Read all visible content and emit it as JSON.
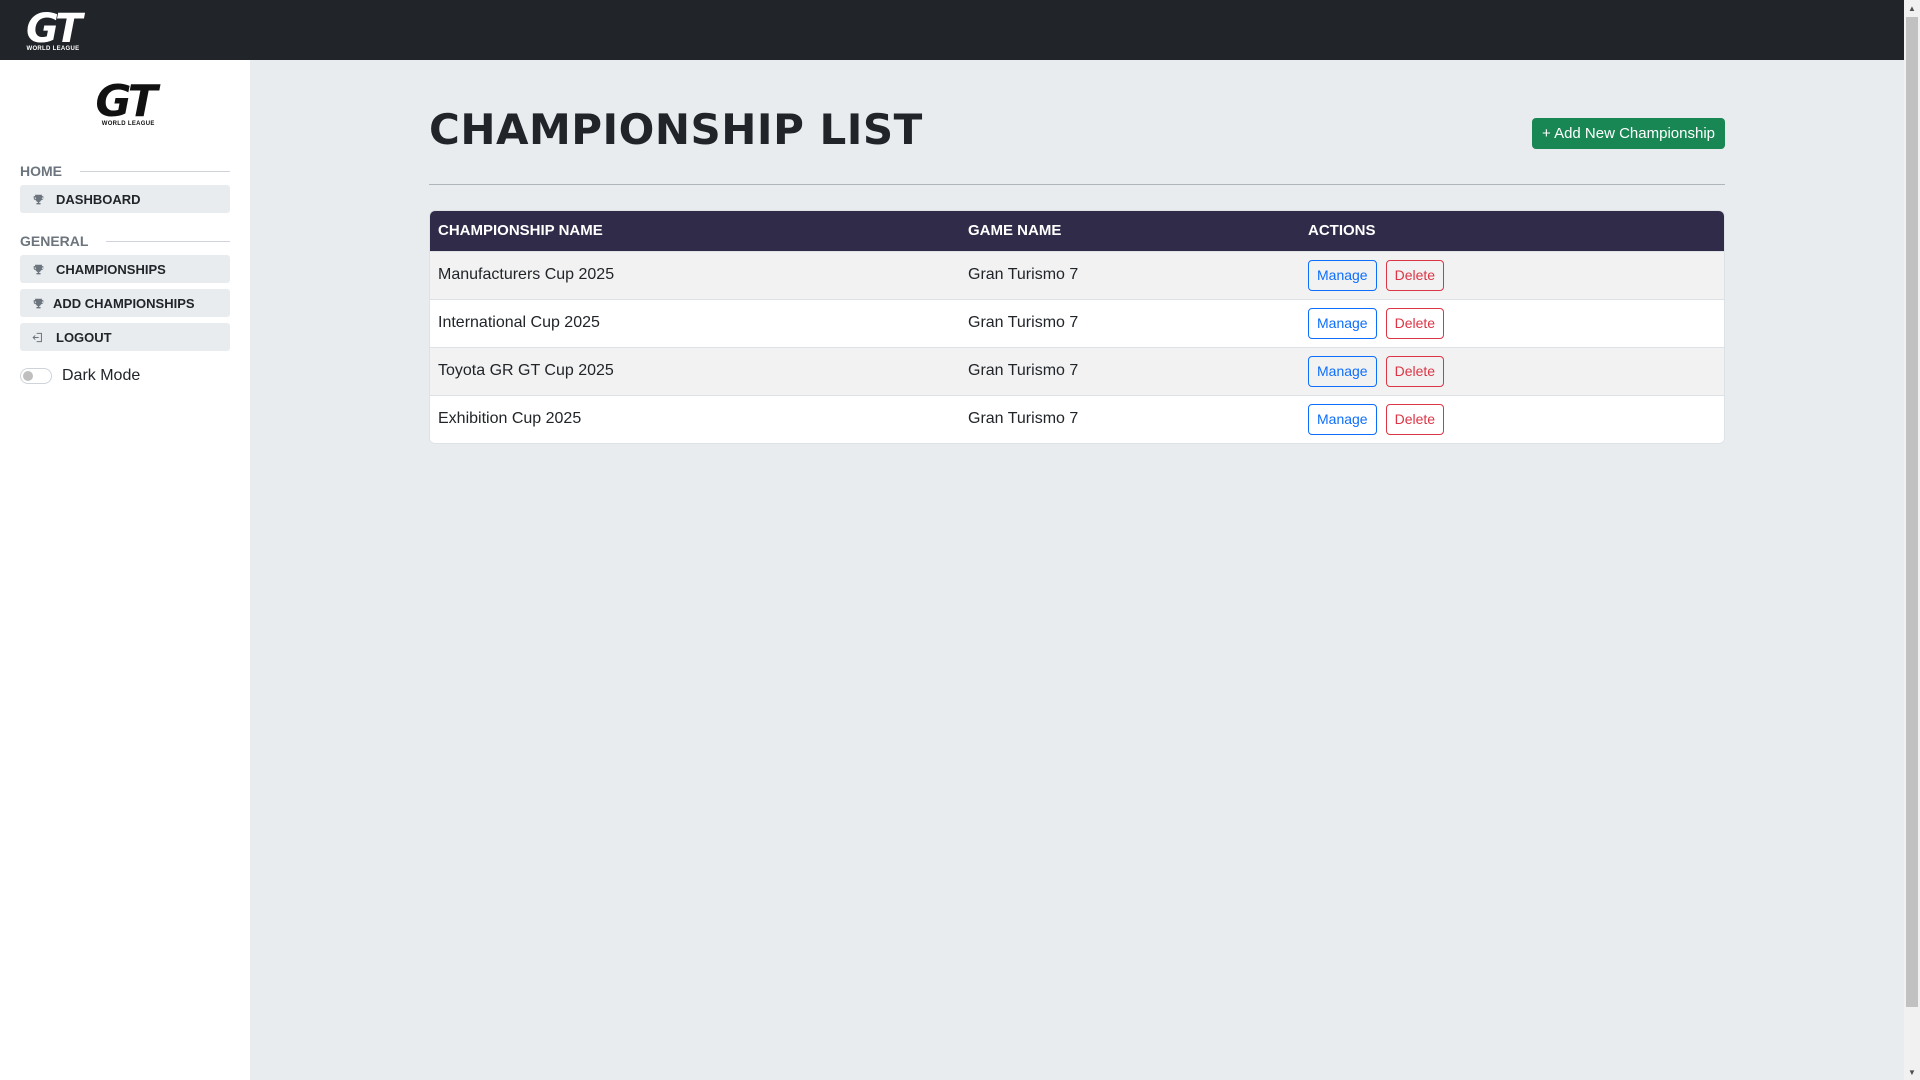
{
  "app": {
    "logo_text": "GT",
    "logo_subtext": "WORLD LEAGUE"
  },
  "sidebar": {
    "sections": [
      {
        "title": "HOME",
        "items": [
          {
            "label": "DASHBOARD",
            "icon": "trophy-icon"
          }
        ]
      },
      {
        "title": "GENERAL",
        "items": [
          {
            "label": "CHAMPIONSHIPS",
            "icon": "trophy-icon"
          },
          {
            "label": "ADD CHAMPIONSHIPS",
            "icon": "trophy-icon"
          },
          {
            "label": "LOGOUT",
            "icon": "logout-icon"
          }
        ]
      }
    ],
    "dark_mode_label": "Dark Mode",
    "dark_mode_on": false
  },
  "main": {
    "title": "CHAMPIONSHIP LIST",
    "add_button_label": "+ Add New Championship",
    "table": {
      "headers": [
        "CHAMPIONSHIP NAME",
        "GAME NAME",
        "ACTIONS"
      ],
      "rows": [
        {
          "name": "Manufacturers Cup 2025",
          "game": "Gran Turismo 7"
        },
        {
          "name": "International Cup 2025",
          "game": "Gran Turismo 7"
        },
        {
          "name": "Toyota GR GT Cup 2025",
          "game": "Gran Turismo 7"
        },
        {
          "name": "Exhibition Cup 2025",
          "game": "Gran Turismo 7"
        }
      ],
      "manage_label": "Manage",
      "delete_label": "Delete"
    }
  },
  "colors": {
    "topbar": "#212529",
    "table_header": "#312b4a",
    "add_button": "#198754",
    "manage": "#0d6efd",
    "delete": "#dc3545"
  }
}
